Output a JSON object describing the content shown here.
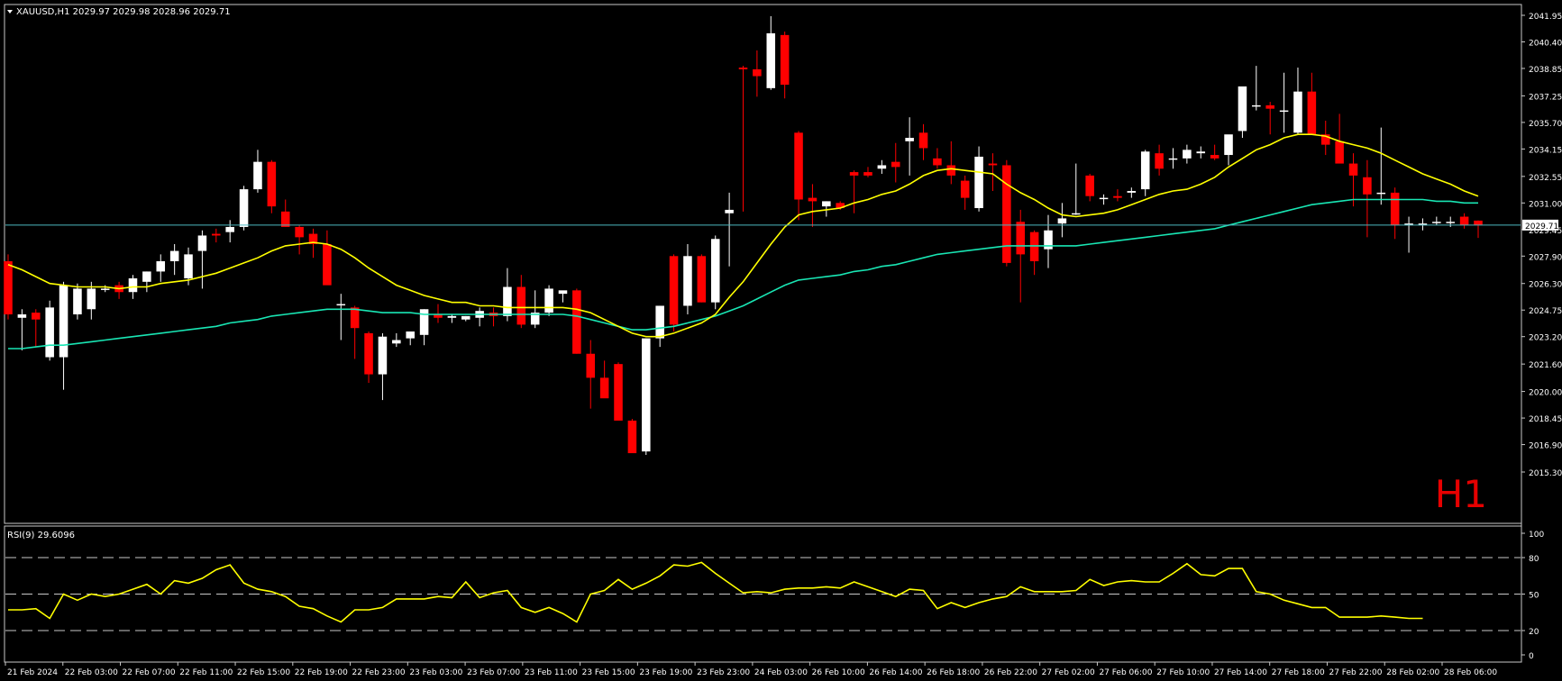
{
  "header": {
    "symbol_line": "XAUUSD,H1  2029.97 2029.98 2028.96 2029.71"
  },
  "timeframe_label": "H1",
  "price_axis": {
    "ticks": [
      "2041.95",
      "2040.40",
      "2038.85",
      "2037.25",
      "2035.70",
      "2034.15",
      "2032.55",
      "2031.00",
      "2029.45",
      "2027.90",
      "2026.30",
      "2024.75",
      "2023.20",
      "2021.60",
      "2020.00",
      "2018.45",
      "2016.90",
      "2015.30"
    ],
    "current_price": "2029.71"
  },
  "time_axis": {
    "ticks": [
      "21 Feb 2024",
      "22 Feb 03:00",
      "22 Feb 07:00",
      "22 Feb 11:00",
      "22 Feb 15:00",
      "22 Feb 19:00",
      "22 Feb 23:00",
      "23 Feb 03:00",
      "23 Feb 07:00",
      "23 Feb 11:00",
      "23 Feb 15:00",
      "23 Feb 19:00",
      "23 Feb 23:00",
      "24 Feb 03:00",
      "26 Feb 10:00",
      "26 Feb 14:00",
      "26 Feb 18:00",
      "26 Feb 22:00",
      "27 Feb 02:00",
      "27 Feb 06:00",
      "27 Feb 10:00",
      "27 Feb 14:00",
      "27 Feb 18:00",
      "27 Feb 22:00",
      "28 Feb 02:00",
      "28 Feb 06:00"
    ]
  },
  "rsi": {
    "label": "RSI(9) 29.6096",
    "ticks": [
      "100",
      "80",
      "50",
      "20",
      "0"
    ]
  },
  "colors": {
    "background": "#000000",
    "bull": "#ffffff",
    "bear": "#ff0000",
    "ma_fast": "#ffff00",
    "ma_slow": "#19e6b4",
    "rsi_line": "#ffff00",
    "price_line": "#4cb8c0",
    "timeframe_label": "#e60000",
    "axis_text": "#ffffff"
  },
  "chart_data": {
    "type": "candlestick",
    "symbol": "XAUUSD",
    "timeframe": "H1",
    "ylim": [
      2015.3,
      2042.6
    ],
    "ohlc": [
      [
        2027.6,
        2028.0,
        2024.2,
        2024.5
      ],
      [
        2024.3,
        2024.8,
        2022.4,
        2024.5
      ],
      [
        2024.6,
        2024.8,
        2022.6,
        2024.2
      ],
      [
        2022.0,
        2025.3,
        2021.8,
        2024.9
      ],
      [
        2022.0,
        2026.4,
        2020.1,
        2026.2
      ],
      [
        2024.5,
        2026.3,
        2024.2,
        2026.0
      ],
      [
        2024.8,
        2026.4,
        2024.2,
        2026.0
      ],
      [
        2026.0,
        2026.2,
        2025.8,
        2026.0
      ],
      [
        2026.2,
        2026.4,
        2025.4,
        2025.8
      ],
      [
        2025.8,
        2026.8,
        2025.4,
        2026.6
      ],
      [
        2026.4,
        2027.0,
        2025.8,
        2027.0
      ],
      [
        2027.0,
        2028.0,
        2026.4,
        2027.6
      ],
      [
        2027.6,
        2028.6,
        2026.8,
        2028.2
      ],
      [
        2026.6,
        2028.4,
        2026.2,
        2028.0
      ],
      [
        2028.2,
        2029.4,
        2026.0,
        2029.1
      ],
      [
        2029.2,
        2029.5,
        2028.7,
        2029.1
      ],
      [
        2029.3,
        2030.0,
        2028.7,
        2029.6
      ],
      [
        2029.6,
        2032.0,
        2029.4,
        2031.8
      ],
      [
        2031.8,
        2034.1,
        2031.6,
        2033.4
      ],
      [
        2033.4,
        2033.5,
        2030.4,
        2030.8
      ],
      [
        2030.5,
        2031.2,
        2029.6,
        2029.6
      ],
      [
        2029.6,
        2029.7,
        2028.0,
        2029.0
      ],
      [
        2029.2,
        2029.5,
        2027.8,
        2028.6
      ],
      [
        2028.6,
        2029.4,
        2026.6,
        2026.2
      ],
      [
        2025.1,
        2025.7,
        2023.0,
        2025.1
      ],
      [
        2024.9,
        2025.0,
        2021.9,
        2023.7
      ],
      [
        2023.4,
        2023.5,
        2020.5,
        2021.0
      ],
      [
        2021.0,
        2023.4,
        2019.5,
        2023.2
      ],
      [
        2022.8,
        2023.4,
        2022.6,
        2023.0
      ],
      [
        2023.1,
        2023.5,
        2022.7,
        2023.5
      ],
      [
        2023.3,
        2024.8,
        2022.7,
        2024.8
      ],
      [
        2024.5,
        2025.1,
        2024.0,
        2024.3
      ],
      [
        2024.3,
        2024.5,
        2024.0,
        2024.4
      ],
      [
        2024.2,
        2024.4,
        2024.1,
        2024.4
      ],
      [
        2024.3,
        2024.9,
        2023.8,
        2024.7
      ],
      [
        2024.6,
        2024.9,
        2023.8,
        2024.4
      ],
      [
        2024.4,
        2027.2,
        2024.1,
        2026.1
      ],
      [
        2026.1,
        2026.8,
        2023.7,
        2023.9
      ],
      [
        2023.9,
        2025.9,
        2023.7,
        2024.6
      ],
      [
        2024.6,
        2026.2,
        2024.4,
        2026.0
      ],
      [
        2025.7,
        2025.8,
        2025.2,
        2025.9
      ],
      [
        2025.9,
        2026.0,
        2022.2,
        2022.2
      ],
      [
        2022.2,
        2023.0,
        2019.0,
        2020.8
      ],
      [
        2020.8,
        2021.8,
        2020.0,
        2019.6
      ],
      [
        2021.6,
        2021.7,
        2018.7,
        2018.3
      ],
      [
        2018.3,
        2018.4,
        2016.9,
        2016.4
      ],
      [
        2016.5,
        2023.1,
        2016.3,
        2023.1
      ],
      [
        2023.1,
        2025.0,
        2022.6,
        2025.0
      ],
      [
        2027.9,
        2028.0,
        2023.5,
        2023.9
      ],
      [
        2025.0,
        2028.6,
        2024.5,
        2027.9
      ],
      [
        2027.9,
        2028.0,
        2025.2,
        2025.2
      ],
      [
        2025.2,
        2029.1,
        2024.8,
        2028.9
      ],
      [
        2030.4,
        2031.6,
        2027.3,
        2030.6
      ],
      [
        2038.9,
        2039.0,
        2030.5,
        2038.8
      ],
      [
        2038.8,
        2039.9,
        2037.2,
        2038.4
      ],
      [
        2037.7,
        2041.9,
        2037.6,
        2040.9
      ],
      [
        2040.8,
        2041.0,
        2037.1,
        2037.9
      ],
      [
        2035.1,
        2035.2,
        2030.0,
        2031.2
      ],
      [
        2031.3,
        2032.1,
        2029.6,
        2031.1
      ],
      [
        2030.8,
        2031.1,
        2030.2,
        2031.1
      ],
      [
        2031.0,
        2031.1,
        2030.6,
        2030.7
      ],
      [
        2032.8,
        2032.9,
        2030.4,
        2032.6
      ],
      [
        2032.8,
        2033.1,
        2032.5,
        2032.6
      ],
      [
        2033.0,
        2033.5,
        2032.7,
        2033.2
      ],
      [
        2033.4,
        2034.5,
        2032.2,
        2033.1
      ],
      [
        2034.6,
        2036.0,
        2032.6,
        2034.8
      ],
      [
        2035.1,
        2035.6,
        2033.5,
        2034.2
      ],
      [
        2033.6,
        2034.2,
        2033.0,
        2033.2
      ],
      [
        2033.2,
        2034.6,
        2032.1,
        2032.6
      ],
      [
        2032.3,
        2032.6,
        2030.6,
        2031.3
      ],
      [
        2030.7,
        2034.3,
        2030.5,
        2033.7
      ],
      [
        2033.3,
        2033.9,
        2031.7,
        2033.2
      ],
      [
        2033.2,
        2033.5,
        2027.3,
        2027.5
      ],
      [
        2029.9,
        2030.6,
        2025.2,
        2028.0
      ],
      [
        2029.3,
        2029.4,
        2026.8,
        2027.6
      ],
      [
        2028.3,
        2030.3,
        2027.2,
        2029.4
      ],
      [
        2029.8,
        2031.0,
        2029.0,
        2030.1
      ],
      [
        2030.4,
        2033.3,
        2030.3,
        2030.4
      ],
      [
        2032.6,
        2032.7,
        2031.1,
        2031.4
      ],
      [
        2031.3,
        2031.5,
        2030.9,
        2031.3
      ],
      [
        2031.4,
        2031.8,
        2031.1,
        2031.3
      ],
      [
        2031.6,
        2031.9,
        2031.3,
        2031.7
      ],
      [
        2031.8,
        2034.1,
        2031.4,
        2034.0
      ],
      [
        2033.9,
        2034.4,
        2032.6,
        2033.0
      ],
      [
        2033.6,
        2034.2,
        2033.0,
        2033.6
      ],
      [
        2033.6,
        2034.4,
        2033.3,
        2034.1
      ],
      [
        2033.9,
        2034.3,
        2033.6,
        2034.0
      ],
      [
        2033.8,
        2034.4,
        2033.5,
        2033.6
      ],
      [
        2033.8,
        2034.7,
        2033.2,
        2035.0
      ],
      [
        2035.2,
        2037.6,
        2034.8,
        2037.8
      ],
      [
        2036.7,
        2039.0,
        2036.4,
        2036.7
      ],
      [
        2036.7,
        2036.9,
        2035.0,
        2036.5
      ],
      [
        2036.4,
        2038.6,
        2035.1,
        2036.4
      ],
      [
        2035.1,
        2038.9,
        2035.0,
        2037.5
      ],
      [
        2037.5,
        2038.6,
        2035.3,
        2035.0
      ],
      [
        2035.0,
        2035.8,
        2033.8,
        2034.4
      ],
      [
        2034.6,
        2036.2,
        2033.5,
        2033.3
      ],
      [
        2033.3,
        2033.9,
        2030.8,
        2032.6
      ],
      [
        2032.5,
        2033.5,
        2029.0,
        2031.5
      ],
      [
        2031.6,
        2035.4,
        2030.9,
        2031.6
      ],
      [
        2031.6,
        2031.9,
        2028.9,
        2029.7
      ],
      [
        2029.7,
        2030.2,
        2028.1,
        2029.8
      ],
      [
        2029.7,
        2030.1,
        2029.4,
        2029.8
      ],
      [
        2029.9,
        2030.2,
        2029.7,
        2029.9
      ],
      [
        2029.9,
        2030.2,
        2029.6,
        2029.9
      ],
      [
        2030.2,
        2030.4,
        2029.5,
        2029.7
      ],
      [
        2029.97,
        2029.98,
        2028.96,
        2029.71
      ]
    ],
    "ma_fast": [
      2027.4,
      2027.1,
      2026.7,
      2026.3,
      2026.2,
      2026.1,
      2026.1,
      2026.1,
      2026.0,
      2026.1,
      2026.1,
      2026.3,
      2026.4,
      2026.5,
      2026.7,
      2026.9,
      2027.2,
      2027.5,
      2027.8,
      2028.2,
      2028.5,
      2028.6,
      2028.7,
      2028.6,
      2028.3,
      2027.8,
      2027.2,
      2026.7,
      2026.2,
      2025.9,
      2025.6,
      2025.4,
      2025.2,
      2025.2,
      2025.0,
      2025.0,
      2024.9,
      2024.9,
      2024.9,
      2024.9,
      2024.9,
      2024.8,
      2024.6,
      2024.2,
      2023.8,
      2023.4,
      2023.2,
      2023.2,
      2023.4,
      2023.7,
      2024.0,
      2024.5,
      2025.5,
      2026.4,
      2027.5,
      2028.6,
      2029.6,
      2030.3,
      2030.5,
      2030.6,
      2030.7,
      2031.0,
      2031.2,
      2031.5,
      2031.7,
      2032.1,
      2032.6,
      2032.9,
      2033.0,
      2032.9,
      2032.8,
      2032.7,
      2032.1,
      2031.6,
      2031.2,
      2030.7,
      2030.3,
      2030.2,
      2030.3,
      2030.4,
      2030.6,
      2030.9,
      2031.2,
      2031.5,
      2031.7,
      2031.8,
      2032.1,
      2032.5,
      2033.1,
      2033.6,
      2034.1,
      2034.4,
      2034.8,
      2035.0,
      2035.0,
      2034.9,
      2034.6,
      2034.4,
      2034.2,
      2033.9,
      2033.5,
      2033.1,
      2032.7,
      2032.4,
      2032.1,
      2031.7,
      2031.4
    ],
    "ma_slow": [
      2022.5,
      2022.5,
      2022.6,
      2022.7,
      2022.7,
      2022.8,
      2022.9,
      2023.0,
      2023.1,
      2023.2,
      2023.3,
      2023.4,
      2023.5,
      2023.6,
      2023.7,
      2023.8,
      2024.0,
      2024.1,
      2024.2,
      2024.4,
      2024.5,
      2024.6,
      2024.7,
      2024.8,
      2024.8,
      2024.8,
      2024.7,
      2024.6,
      2024.6,
      2024.6,
      2024.5,
      2024.5,
      2024.5,
      2024.5,
      2024.5,
      2024.5,
      2024.5,
      2024.5,
      2024.5,
      2024.5,
      2024.5,
      2024.4,
      2024.2,
      2024.0,
      2023.8,
      2023.6,
      2023.6,
      2023.7,
      2023.8,
      2024.0,
      2024.2,
      2024.4,
      2024.7,
      2025.0,
      2025.4,
      2025.8,
      2026.2,
      2026.5,
      2026.6,
      2026.7,
      2026.8,
      2027.0,
      2027.1,
      2027.3,
      2027.4,
      2027.6,
      2027.8,
      2028.0,
      2028.1,
      2028.2,
      2028.3,
      2028.4,
      2028.5,
      2028.5,
      2028.5,
      2028.5,
      2028.5,
      2028.5,
      2028.6,
      2028.7,
      2028.8,
      2028.9,
      2029.0,
      2029.1,
      2029.2,
      2029.3,
      2029.4,
      2029.5,
      2029.7,
      2029.9,
      2030.1,
      2030.3,
      2030.5,
      2030.7,
      2030.9,
      2031.0,
      2031.1,
      2031.2,
      2031.2,
      2031.2,
      2031.2,
      2031.2,
      2031.2,
      2031.1,
      2031.1,
      2031.0,
      2031.0
    ],
    "rsi_values": [
      37,
      37,
      38,
      30,
      50,
      45,
      50,
      48,
      50,
      54,
      58,
      50,
      61,
      59,
      63,
      70,
      74,
      59,
      54,
      52,
      48,
      40,
      38,
      32,
      27,
      37,
      37,
      39,
      46,
      46,
      46,
      48,
      47,
      60,
      47,
      51,
      53,
      39,
      35,
      39,
      34,
      27,
      50,
      53,
      62,
      54,
      59,
      65,
      74,
      73,
      76,
      67,
      59,
      51,
      52,
      51,
      54,
      55,
      55,
      56,
      55,
      60,
      56,
      52,
      48,
      54,
      53,
      38,
      43,
      39,
      43,
      46,
      48,
      56,
      52,
      52,
      52,
      53,
      62,
      57,
      60,
      61,
      60,
      60,
      67,
      75,
      66,
      65,
      71,
      71,
      52,
      50,
      45,
      42,
      39,
      39,
      31,
      31,
      31,
      32,
      31,
      30,
      30
    ],
    "rsi_ylim": [
      0,
      100
    ],
    "rsi_levels": [
      80,
      50,
      20
    ]
  }
}
